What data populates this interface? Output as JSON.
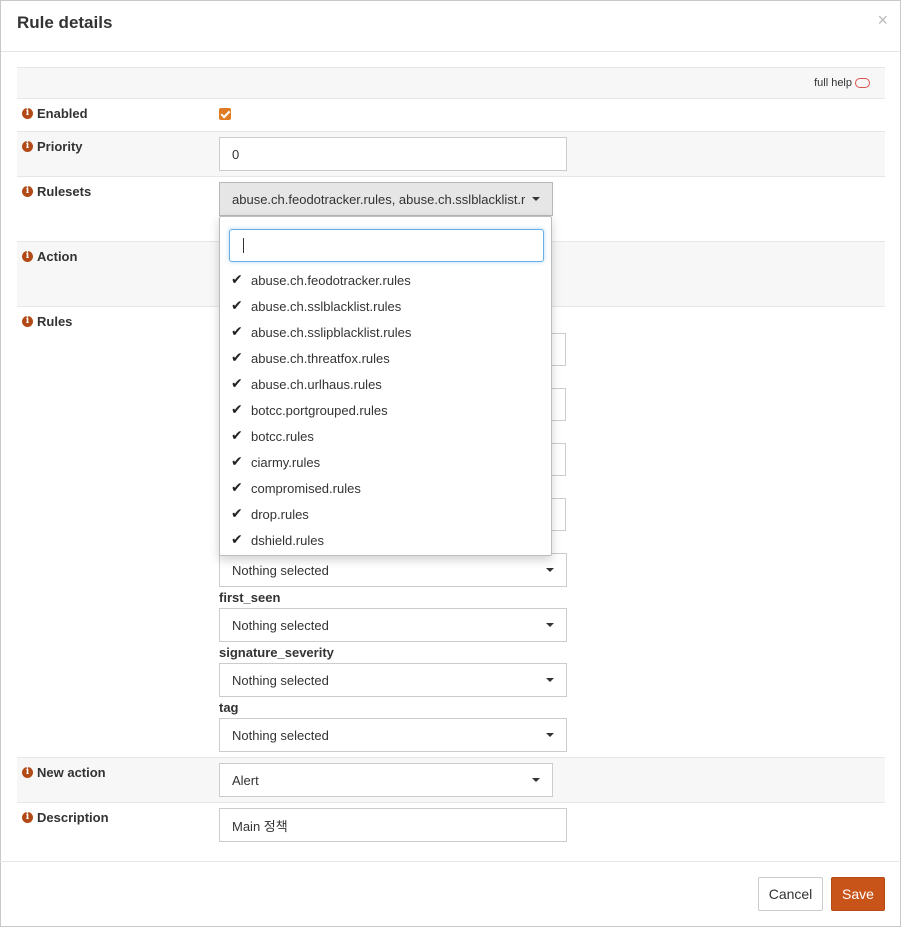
{
  "modal": {
    "title": "Rule details",
    "close": "×"
  },
  "help": {
    "full_help": "full help"
  },
  "labels": {
    "enabled": "Enabled",
    "priority": "Priority",
    "rulesets": "Rulesets",
    "action": "Action",
    "rules": "Rules",
    "new_action": "New action",
    "description": "Description"
  },
  "fields": {
    "enabled": true,
    "priority": "0",
    "rulesets_selected": "abuse.ch.feodotracker.rules, abuse.ch.sslblacklist.r",
    "new_action": "Alert",
    "description": "Main 정책"
  },
  "rules_filters": [
    {
      "label": "",
      "value": "Nothing selected"
    },
    {
      "label": "first_seen",
      "value": "Nothing selected"
    },
    {
      "label": "signature_severity",
      "value": "Nothing selected"
    },
    {
      "label": "tag",
      "value": "Nothing selected"
    }
  ],
  "dropdown": {
    "search_value": "",
    "items": [
      "abuse.ch.feodotracker.rules",
      "abuse.ch.sslblacklist.rules",
      "abuse.ch.sslipblacklist.rules",
      "abuse.ch.threatfox.rules",
      "abuse.ch.urlhaus.rules",
      "botcc.portgrouped.rules",
      "botcc.rules",
      "ciarmy.rules",
      "compromised.rules",
      "drop.rules",
      "dshield.rules"
    ]
  },
  "buttons": {
    "cancel": "Cancel",
    "save": "Save"
  },
  "colors": {
    "accent": "#c9541a",
    "checkbox": "#e07b24",
    "info_icon": "#b24a17"
  }
}
